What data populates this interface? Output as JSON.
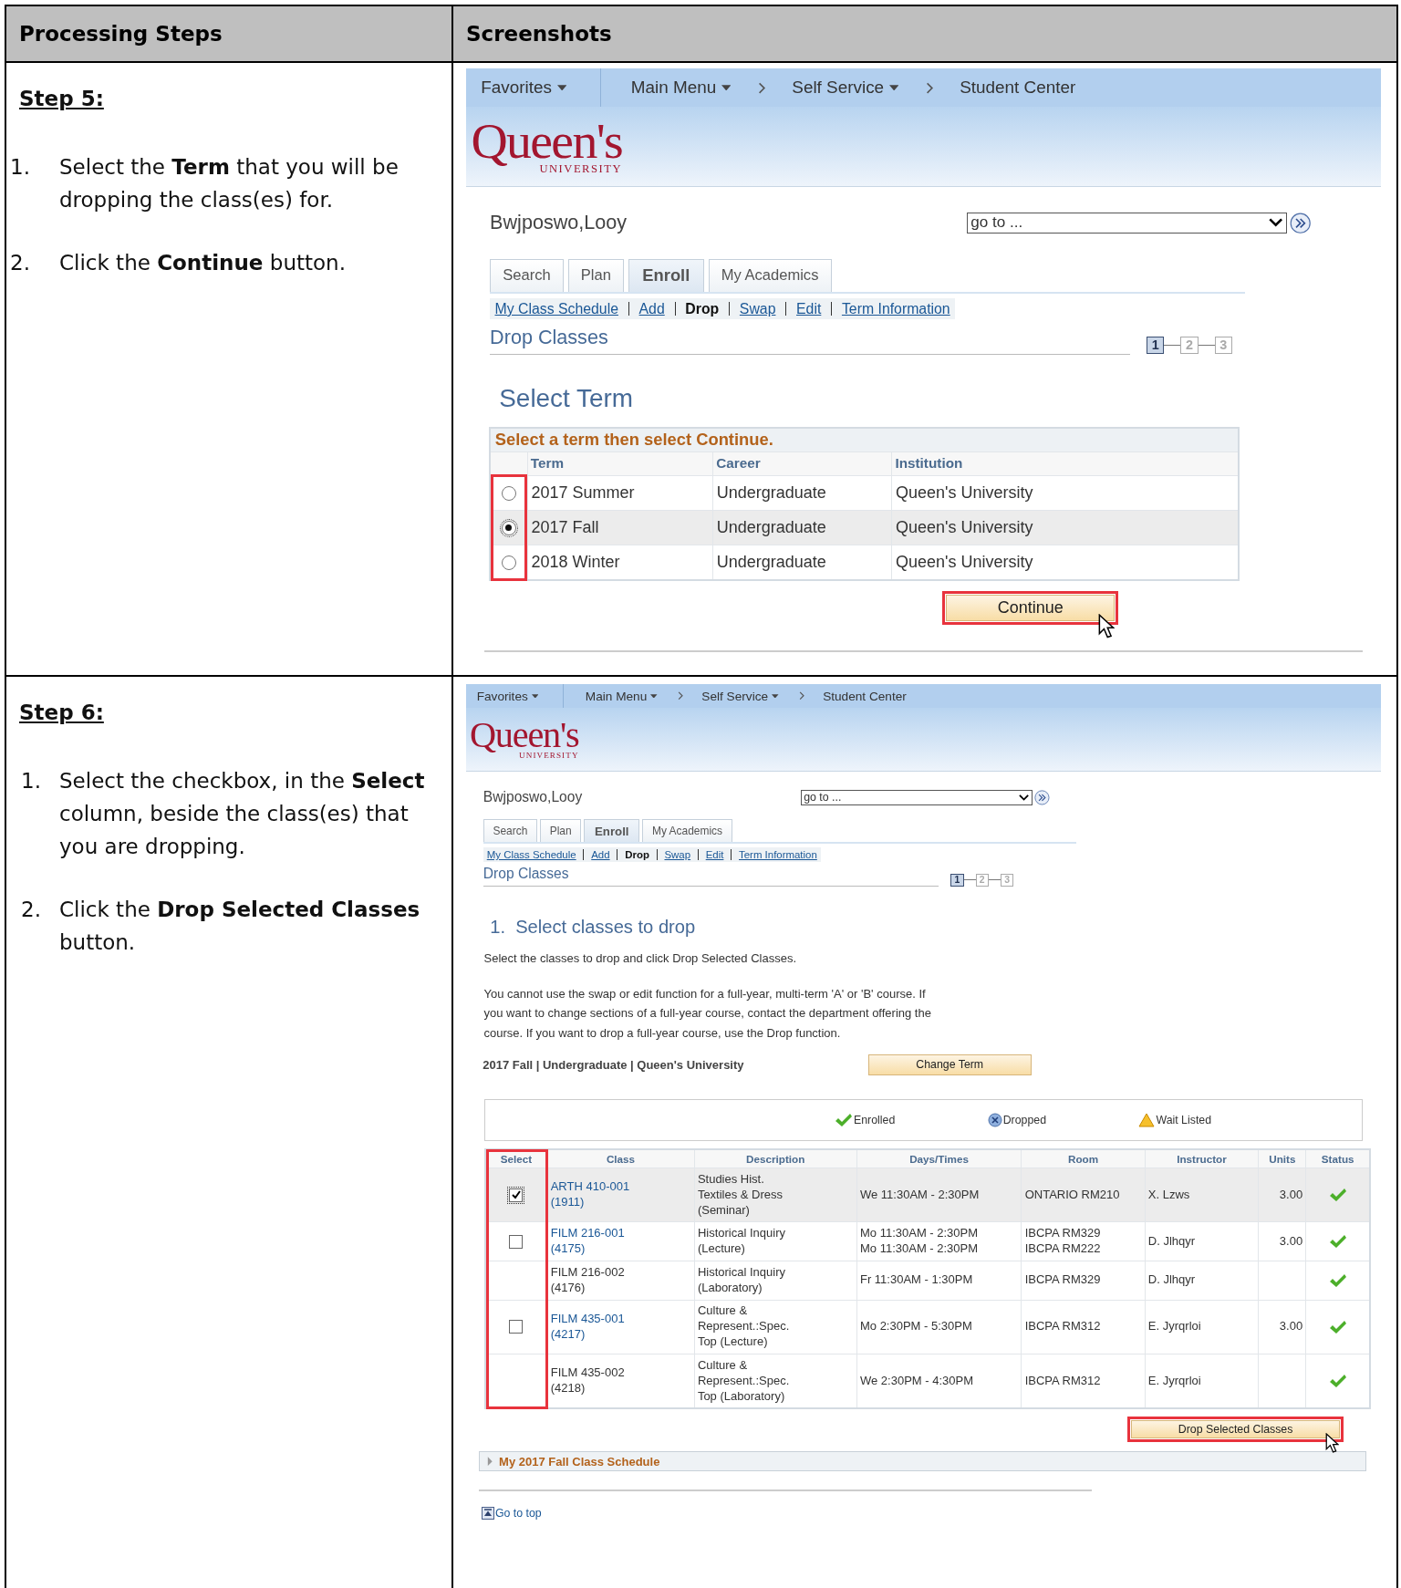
{
  "columns": [
    "Processing Steps",
    "Screenshots"
  ],
  "steps": [
    {
      "title": "Step 5:",
      "items": [
        {
          "number": "1.",
          "text": "Select the **Term** that you will be dropping the class(es) for."
        },
        {
          "number": "2.",
          "text": "Click the **Continue** button."
        }
      ],
      "screenshot": {
        "kind": "select_term",
        "header": {
          "nav": [
            {
              "label": "Favorites",
              "dropdown": true,
              "breadcrumb": false
            },
            {
              "label": "Main Menu",
              "dropdown": true,
              "breadcrumb": false
            },
            {
              "label": "Self Service",
              "dropdown": true,
              "breadcrumb": true
            },
            {
              "label": "Student Center",
              "dropdown": false,
              "breadcrumb": true
            }
          ],
          "logo": {
            "wordmark": "Queen's",
            "subtitle": "UNIVERSITY"
          },
          "student_name": "Bwjposwo,Looy",
          "goto": {
            "value": "go to ..."
          },
          "tabs": [
            {
              "label": "Search",
              "selected": false
            },
            {
              "label": "Plan",
              "selected": false
            },
            {
              "label": "Enroll",
              "selected": true
            },
            {
              "label": "My Academics",
              "selected": false
            }
          ],
          "links": [
            {
              "label": "My Class Schedule",
              "selected": false
            },
            {
              "label": "Add",
              "selected": false
            },
            {
              "label": "Drop",
              "selected": true
            },
            {
              "label": "Swap",
              "selected": false
            },
            {
              "label": "Edit",
              "selected": false
            },
            {
              "label": "Term Information",
              "selected": false
            }
          ],
          "page_title": "Drop Classes",
          "progress": [
            {
              "label": "1",
              "selected": true
            },
            {
              "label": "2",
              "selected": false
            },
            {
              "label": "3",
              "selected": false
            }
          ]
        },
        "section_title": "Select Term",
        "grid": {
          "caption": "Select a term then select Continue.",
          "columns": [
            "Term",
            "Career",
            "Institution"
          ],
          "rows": [
            {
              "selected": false,
              "cells": [
                "2017 Summer",
                "Undergraduate",
                "Queen's University"
              ]
            },
            {
              "selected": true,
              "cells": [
                "2017 Fall",
                "Undergraduate",
                "Queen's University"
              ]
            },
            {
              "selected": false,
              "cells": [
                "2018 Winter",
                "Undergraduate",
                "Queen's University"
              ]
            }
          ]
        },
        "button": "Continue"
      }
    },
    {
      "title": "Step 6:",
      "items": [
        {
          "number": "1.",
          "text": "Select the checkbox, in the **Select** column, beside the class(es) that you are dropping."
        },
        {
          "number": "2.",
          "text": "Click the **Drop Selected Classes** button."
        }
      ],
      "screenshot": {
        "kind": "drop_classes",
        "header": {
          "nav": [
            {
              "label": "Favorites",
              "dropdown": true,
              "breadcrumb": false
            },
            {
              "label": "Main Menu",
              "dropdown": true,
              "breadcrumb": false
            },
            {
              "label": "Self Service",
              "dropdown": true,
              "breadcrumb": true
            },
            {
              "label": "Student Center",
              "dropdown": false,
              "breadcrumb": true
            }
          ],
          "logo": {
            "wordmark": "Queen's",
            "subtitle": "UNIVERSITY"
          },
          "student_name": "Bwjposwo,Looy",
          "goto": {
            "value": "go to ..."
          },
          "tabs": [
            {
              "label": "Search",
              "selected": false
            },
            {
              "label": "Plan",
              "selected": false
            },
            {
              "label": "Enroll",
              "selected": true
            },
            {
              "label": "My Academics",
              "selected": false
            }
          ],
          "links": [
            {
              "label": "My Class Schedule",
              "selected": false
            },
            {
              "label": "Add",
              "selected": false
            },
            {
              "label": "Drop",
              "selected": true
            },
            {
              "label": "Swap",
              "selected": false
            },
            {
              "label": "Edit",
              "selected": false
            },
            {
              "label": "Term Information",
              "selected": false
            }
          ],
          "page_title": "Drop Classes",
          "progress": [
            {
              "label": "1",
              "selected": true
            },
            {
              "label": "2",
              "selected": false
            },
            {
              "label": "3",
              "selected": false
            }
          ]
        },
        "section_title": "1.  Select classes to drop",
        "intro": "Select the classes to drop and click Drop Selected Classes.",
        "note": "You cannot use the swap or edit function for a full-year, multi-term 'A' or 'B' course. If you want to change sections of a full-year course, contact the department offering the course. If you want to drop a full-year course, use the Drop function.",
        "term_line": "2017 Fall | Undergraduate | Queen's University",
        "change_term_button": "Change Term",
        "legend": [
          {
            "kind": "enrolled",
            "label": "Enrolled"
          },
          {
            "kind": "dropped",
            "label": "Dropped"
          },
          {
            "kind": "wait_listed",
            "label": "Wait Listed"
          }
        ],
        "classes": {
          "columns": [
            "Select",
            "Class",
            "Description",
            "Days/Times",
            "Room",
            "Instructor",
            "Units",
            "Status"
          ],
          "rows": [
            {
              "selectable": true,
              "checked": true,
              "link": true,
              "class": "ARTH 410-001\n(1911)",
              "description": "Studies Hist.\nTextiles & Dress\n(Seminar)",
              "days_times": "We 11:30AM - 2:30PM",
              "room": "ONTARIO RM210",
              "instructor": "X. Lzws",
              "units": "3.00",
              "kind": "enrolled"
            },
            {
              "selectable": true,
              "checked": false,
              "link": true,
              "class": "FILM 216-001\n(4175)",
              "description": "Historical Inquiry\n(Lecture)",
              "days_times": "Mo 11:30AM - 2:30PM\nMo 11:30AM - 2:30PM",
              "room": "IBCPA RM329\nIBCPA RM222",
              "instructor": "D. Jlhqyr",
              "units": "3.00",
              "kind": "enrolled"
            },
            {
              "selectable": false,
              "checked": false,
              "link": false,
              "class": "FILM 216-002\n(4176)",
              "description": "Historical Inquiry\n(Laboratory)",
              "days_times": "Fr 11:30AM - 1:30PM",
              "room": "IBCPA RM329",
              "instructor": "D. Jlhqyr",
              "kind": "enrolled"
            },
            {
              "selectable": true,
              "checked": false,
              "link": true,
              "class": "FILM 435-001\n(4217)",
              "description": "Culture &\nRepresent.:Spec.\nTop (Lecture)",
              "days_times": "Mo 2:30PM - 5:30PM",
              "room": "IBCPA RM312",
              "instructor": "E. Jyrqrloi",
              "units": "3.00",
              "kind": "enrolled"
            },
            {
              "selectable": false,
              "checked": false,
              "link": false,
              "class": "FILM 435-002\n(4218)",
              "description": "Culture &\nRepresent.:Spec.\nTop (Laboratory)",
              "days_times": "We 2:30PM - 4:30PM",
              "room": "IBCPA RM312",
              "instructor": "E. Jyrqrloi",
              "kind": "enrolled"
            }
          ]
        },
        "drop_button": "Drop Selected Classes",
        "schedule_section": {
          "title": "My 2017 Fall Class Schedule",
          "expanded": false
        },
        "go_to_top": "Go to top"
      }
    }
  ]
}
